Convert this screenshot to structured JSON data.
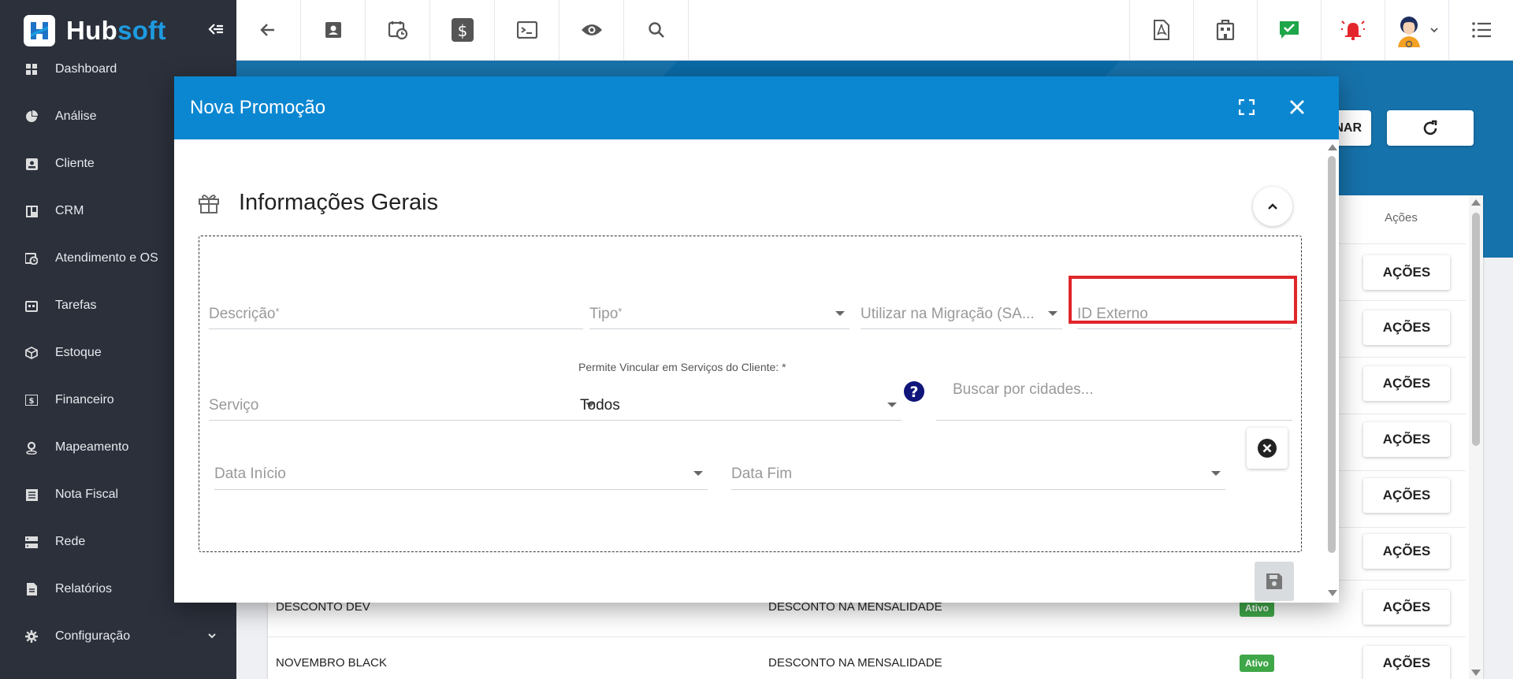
{
  "brand": {
    "name_part1": "Hub",
    "name_part2": "soft"
  },
  "sidebar": {
    "items": [
      {
        "label": "Dashboard",
        "icon": "dashboard-icon"
      },
      {
        "label": "Análise",
        "icon": "pie-chart-icon"
      },
      {
        "label": "Cliente",
        "icon": "contact-card-icon"
      },
      {
        "label": "CRM",
        "icon": "kanban-icon"
      },
      {
        "label": "Atendimento e OS",
        "icon": "calendar-clock-icon"
      },
      {
        "label": "Tarefas",
        "icon": "tasks-icon"
      },
      {
        "label": "Estoque",
        "icon": "box-icon"
      },
      {
        "label": "Financeiro",
        "icon": "money-icon"
      },
      {
        "label": "Mapeamento",
        "icon": "map-pin-icon"
      },
      {
        "label": "Nota Fiscal",
        "icon": "invoice-icon"
      },
      {
        "label": "Rede",
        "icon": "server-icon"
      },
      {
        "label": "Relatórios",
        "icon": "report-icon"
      },
      {
        "label": "Configuração",
        "icon": "gear-icon"
      }
    ]
  },
  "topbar": {
    "left_icons": [
      "back-arrow-icon",
      "contact-card-icon",
      "calendar-clock-icon",
      "dollar-icon",
      "terminal-icon",
      "eye-icon",
      "search-icon"
    ],
    "right_icons": [
      "pdf-icon",
      "building-icon",
      "check-message-icon",
      "alarm-bell-icon",
      "user-avatar",
      "list-menu-icon"
    ],
    "accent_check": "#1fa64a",
    "accent_bell": "#e3262b"
  },
  "background_page": {
    "partial_button_label": "NAR",
    "actions_header": "Ações",
    "actions_button_label": "AÇÕES",
    "rows": [
      {
        "name": "DESCONTO DEV",
        "type": "DESCONTO NA MENSALIDADE",
        "status": "Ativo"
      },
      {
        "name": "NOVEMBRO BLACK",
        "type": "DESCONTO NA MENSALIDADE",
        "status": "Ativo"
      }
    ]
  },
  "modal": {
    "title": "Nova Promoção",
    "header_color": "#0b87d1",
    "section_title": "Informações Gerais",
    "fields": {
      "descricao": {
        "placeholder": "Descrição",
        "required_mark": "*"
      },
      "tipo": {
        "placeholder": "Tipo",
        "required_mark": "*"
      },
      "migracao": {
        "placeholder": "Utilizar na Migração (SA..."
      },
      "id_externo": {
        "placeholder": "ID Externo"
      },
      "servico": {
        "placeholder": "Serviço"
      },
      "permite_vincular": {
        "label": "Permite Vincular em Serviços do Cliente: *",
        "value": "Todos"
      },
      "cidades": {
        "placeholder": "Buscar por cidades..."
      },
      "data_inicio": {
        "placeholder": "Data Início"
      },
      "data_fim": {
        "placeholder": "Data Fim"
      }
    },
    "highlight_color": "#e0262b"
  }
}
